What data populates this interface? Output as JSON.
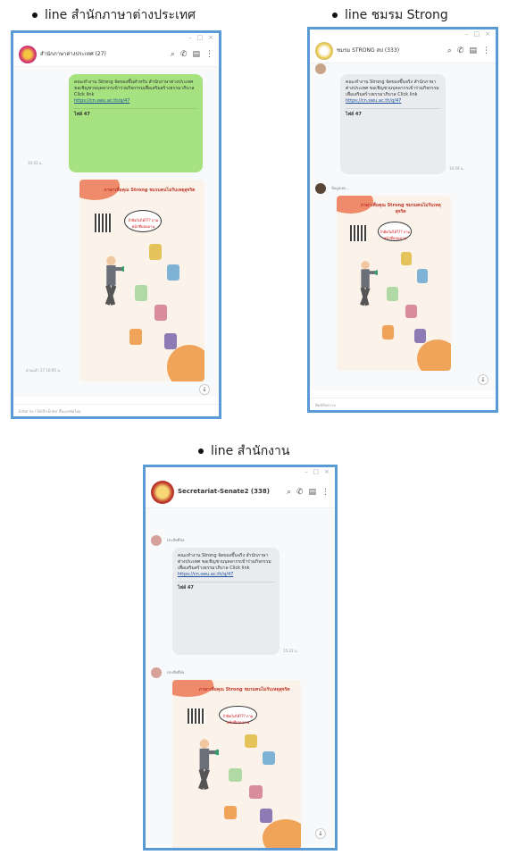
{
  "captions": {
    "top_left": "line สำนักภาษาต่างประเทศ",
    "top_right": "line ชมรม Strong",
    "bottom": "line สำนักงาน"
  },
  "windows": [
    {
      "group_name": "สำนักภาษาต่างประเทศ (27)",
      "message": "คณะทำงาน Strong จัดของขึ้นสำหรับ สำนักภาษาต่างประเทศ ขอเชิญชวนบุคลากรเข้าร่วมกิจกรรมเพื่อเสริมสร้างธรรมาภิบาล Click link",
      "link": "https://cn.swu.ac.th/q/47",
      "preview_title": "ไฟล์ 47",
      "read": "อ่านแล้ว 17",
      "time1": "10:03 น.",
      "time2": "อ่านแล้ว 17 10:05 น.",
      "poster_title": "ภาษาเพื่อคุณ Strong ชมรมคนไม่รับเหตุสุจริต",
      "speech": "ถ้าผิดไม่ได้??? ถามหน้าที่บ่อนบาน",
      "input_hint": "Enter ส่ง / Shift+Enter ขึ้นบรรทัดใหม่"
    },
    {
      "group_name": "ชมรม STRONG สป (333)",
      "message": "คณะทำงาน Strong จัดของขึ้นจริง สำนักภาษาต่างประเทศ ขอเชิญชวนบุคลากรเข้าร่วมกิจกรรม เพื่อเสริมสร้างธรรมาภิบาล Click link",
      "link": "https://cn.swu.ac.th/q/47",
      "preview_title": "ไฟล์ 47",
      "sender": "ข้อมูลเอก...",
      "time1": "16:59 น.",
      "poster_title": "ภาษาเพื่อคุณ Strong ชมรมคนไม่รับเหตุสุจริต",
      "speech": "ถ้าผิดไม่ได้??? ถามหน้าที่บ่อนบาน",
      "input_hint": "พิมพ์ข้อความ"
    },
    {
      "group_name": "Secretariat-Senate2 (338)",
      "sender1": "ประสิทธิ์ชย",
      "message": "คณะทำงาน Strong จัดของขึ้นจริง สำนักภาษาต่างประเทศ ขอเชิญชวนบุคลากรเข้าร่วมกิจกรรมเพื่อเสริมสร้างธรรมาภิบาล Click link",
      "link": "https://cn.swu.ac.th/q/47",
      "preview_title": "ไฟล์ 47",
      "time1": "15:22 น.",
      "sender2": "ประสิทธิ์ชย",
      "poster_title": "ภาษาเพื่อคุณ Strong ชมรมคนไม่รับเหตุสุจริต",
      "speech": "ถ้าผิดไม่ได้??? ถามหน้าที่บ่อนบาน"
    }
  ],
  "colors": {
    "frame_border": "#5b9bd5",
    "bubble_green": "#a6e27f",
    "bubble_gray": "#e9ebee"
  },
  "icons": [
    "search-icon",
    "phone-icon",
    "notes-icon",
    "menu-dots-icon",
    "scroll-down-icon"
  ]
}
